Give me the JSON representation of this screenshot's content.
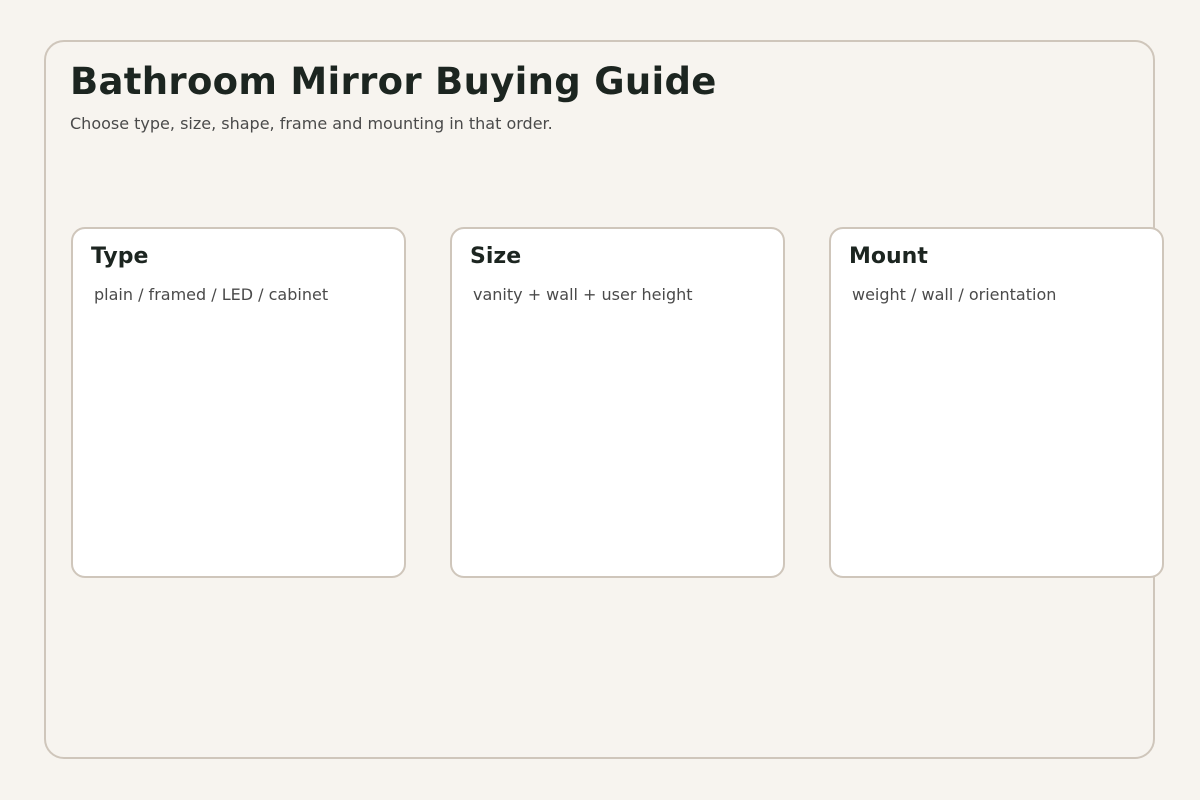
{
  "guide": {
    "title": "Bathroom Mirror Buying Guide",
    "subtitle": "Choose type, size, shape, frame and mounting in that order."
  },
  "cards": [
    {
      "title": "Type",
      "description": "plain / framed / LED / cabinet"
    },
    {
      "title": "Size",
      "description": "vanity + wall + user height"
    },
    {
      "title": "Mount",
      "description": "weight / wall / orientation"
    }
  ],
  "colors": {
    "background": "#f7f4ef",
    "border": "#cfc6bb",
    "heading": "#1c2520",
    "body_text": "#4a4a4a",
    "card_background": "#ffffff"
  }
}
